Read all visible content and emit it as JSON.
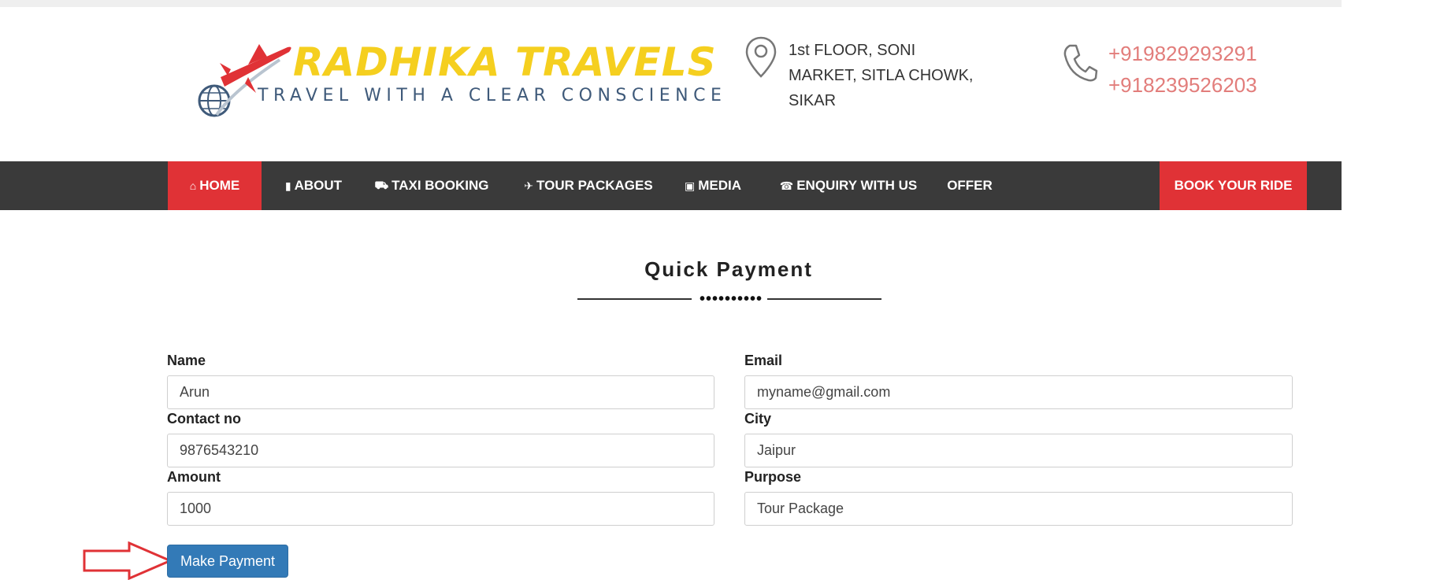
{
  "brand": {
    "name": "RADHIKA TRAVELS",
    "tagline": "TRAVEL WITH A CLEAR CONSCIENCE",
    "colors": {
      "name": "#f5cf1f",
      "tagline": "#3f5a7a",
      "plane": "#e03236"
    }
  },
  "contact": {
    "address_lines": [
      "1st FLOOR, SONI",
      "MARKET, SITLA CHOWK,",
      "SIKAR"
    ],
    "phones": [
      "+919829293291",
      "+918239526203"
    ],
    "address_icon": "map-pin-icon",
    "phone_icon": "phone-icon"
  },
  "nav": {
    "items": [
      {
        "label": "HOME",
        "icon": "home-icon",
        "glyph": "⌂",
        "active": true
      },
      {
        "label": "ABOUT",
        "icon": "document-icon",
        "glyph": "▮"
      },
      {
        "label": "TAXI BOOKING",
        "icon": "car-icon",
        "glyph": "⛟"
      },
      {
        "label": "TOUR PACKAGES",
        "icon": "plane-icon",
        "glyph": "✈"
      },
      {
        "label": "MEDIA",
        "icon": "map-icon",
        "glyph": "▣"
      },
      {
        "label": "ENQUIRY WITH US",
        "icon": "phone-square-icon",
        "glyph": "☎"
      },
      {
        "label": "OFFER",
        "icon": "",
        "glyph": ""
      }
    ],
    "cta": "BOOK YOUR RIDE",
    "colors": {
      "bar": "#3a3a3a",
      "accent": "#e03236"
    }
  },
  "form": {
    "title": "Quick Payment",
    "fields": {
      "name": {
        "label": "Name",
        "value": "Arun"
      },
      "email": {
        "label": "Email",
        "value": "myname@gmail.com"
      },
      "contact": {
        "label": "Contact no",
        "value": "9876543210"
      },
      "city": {
        "label": "City",
        "value": "Jaipur"
      },
      "amount": {
        "label": "Amount",
        "value": "1000"
      },
      "purpose": {
        "label": "Purpose",
        "value": "Tour Package"
      }
    },
    "submit_label": "Make Payment",
    "submit_color": "#337ab7",
    "annotation_arrow_color": "#e03236"
  }
}
